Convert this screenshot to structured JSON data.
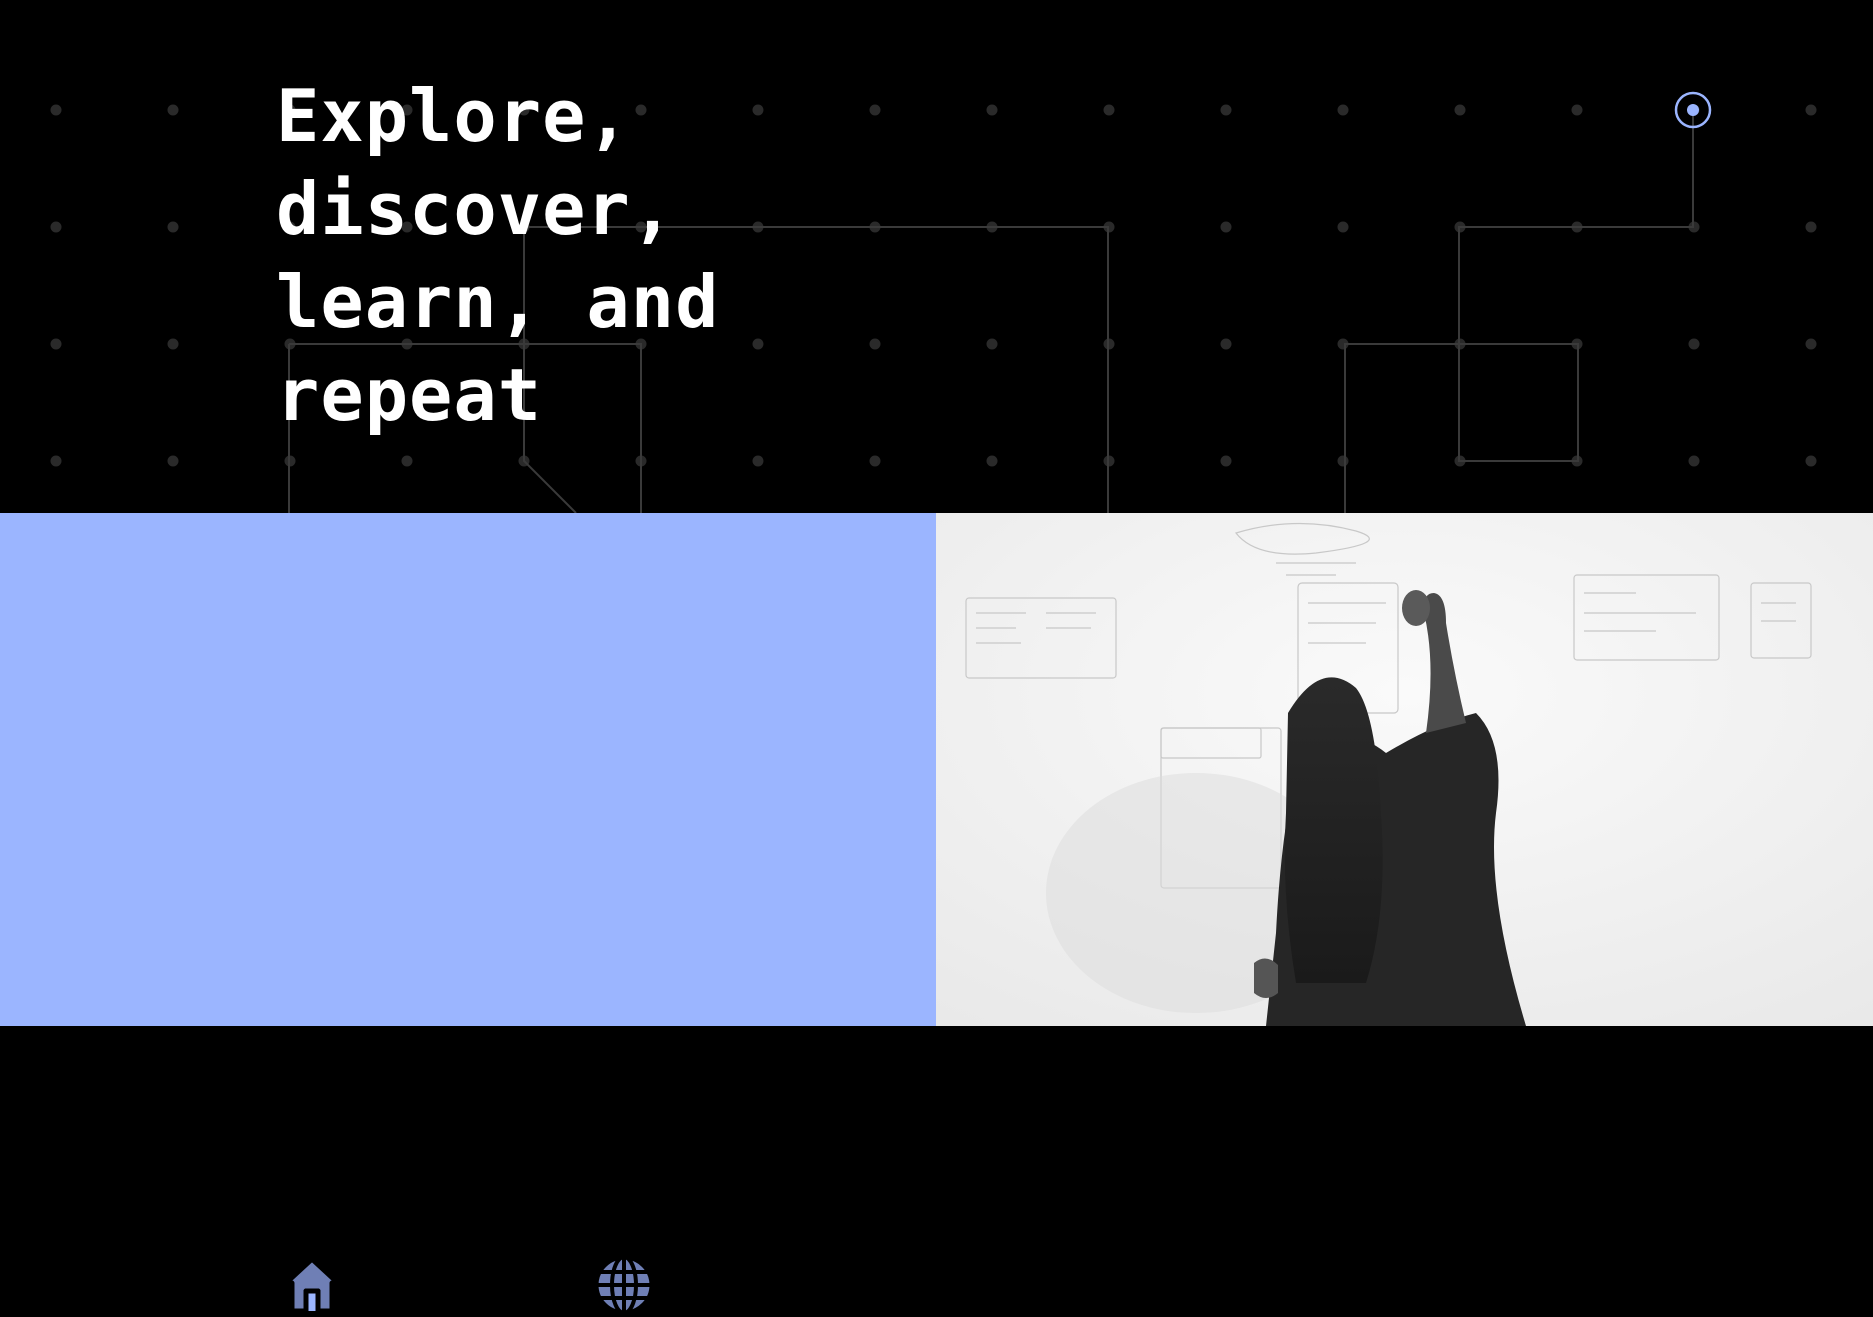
{
  "hero": {
    "title": "Explore,\ndiscover,\nlearn, and\nrepeat",
    "background_color": "#000000",
    "title_color": "#ffffff",
    "grid_dot_color": "#2a2a2a",
    "circuit_line_color": "#3a3a3a",
    "accent_node_color": "#9bb5ff"
  },
  "feature_panel": {
    "background_color": "#9bb5ff",
    "icons": [
      {
        "name": "home-icon"
      },
      {
        "name": "airplane-takeoff-icon"
      },
      {
        "name": "globe-icon"
      }
    ]
  },
  "photo_panel": {
    "description_icon": "person-writing-on-whiteboard-image",
    "background_color": "#f2f2f2"
  }
}
